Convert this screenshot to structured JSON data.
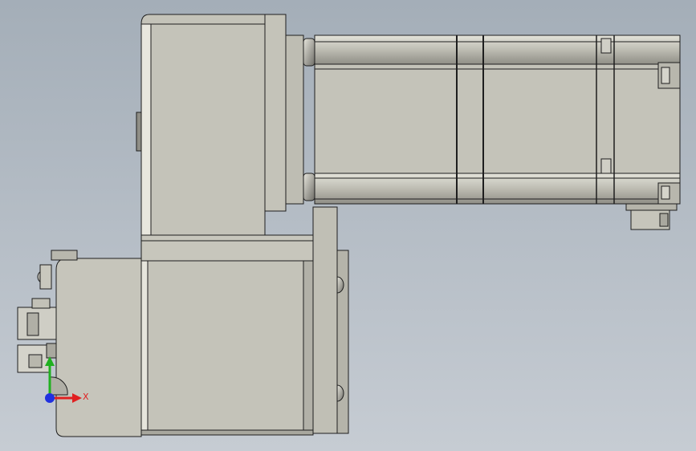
{
  "viewport": {
    "background_top": "#a4aeb8",
    "background_bottom": "#c6ccd3"
  },
  "model": {
    "body_fill": "#c2c1b6",
    "body_shadow": "#9e9d93",
    "body_highlight": "#e2e1d8",
    "edge_color": "#1e1e1e"
  },
  "triad": {
    "x_label": "X",
    "x_color": "#e02020",
    "y_color": "#20b020",
    "z_color": "#2030e0"
  }
}
